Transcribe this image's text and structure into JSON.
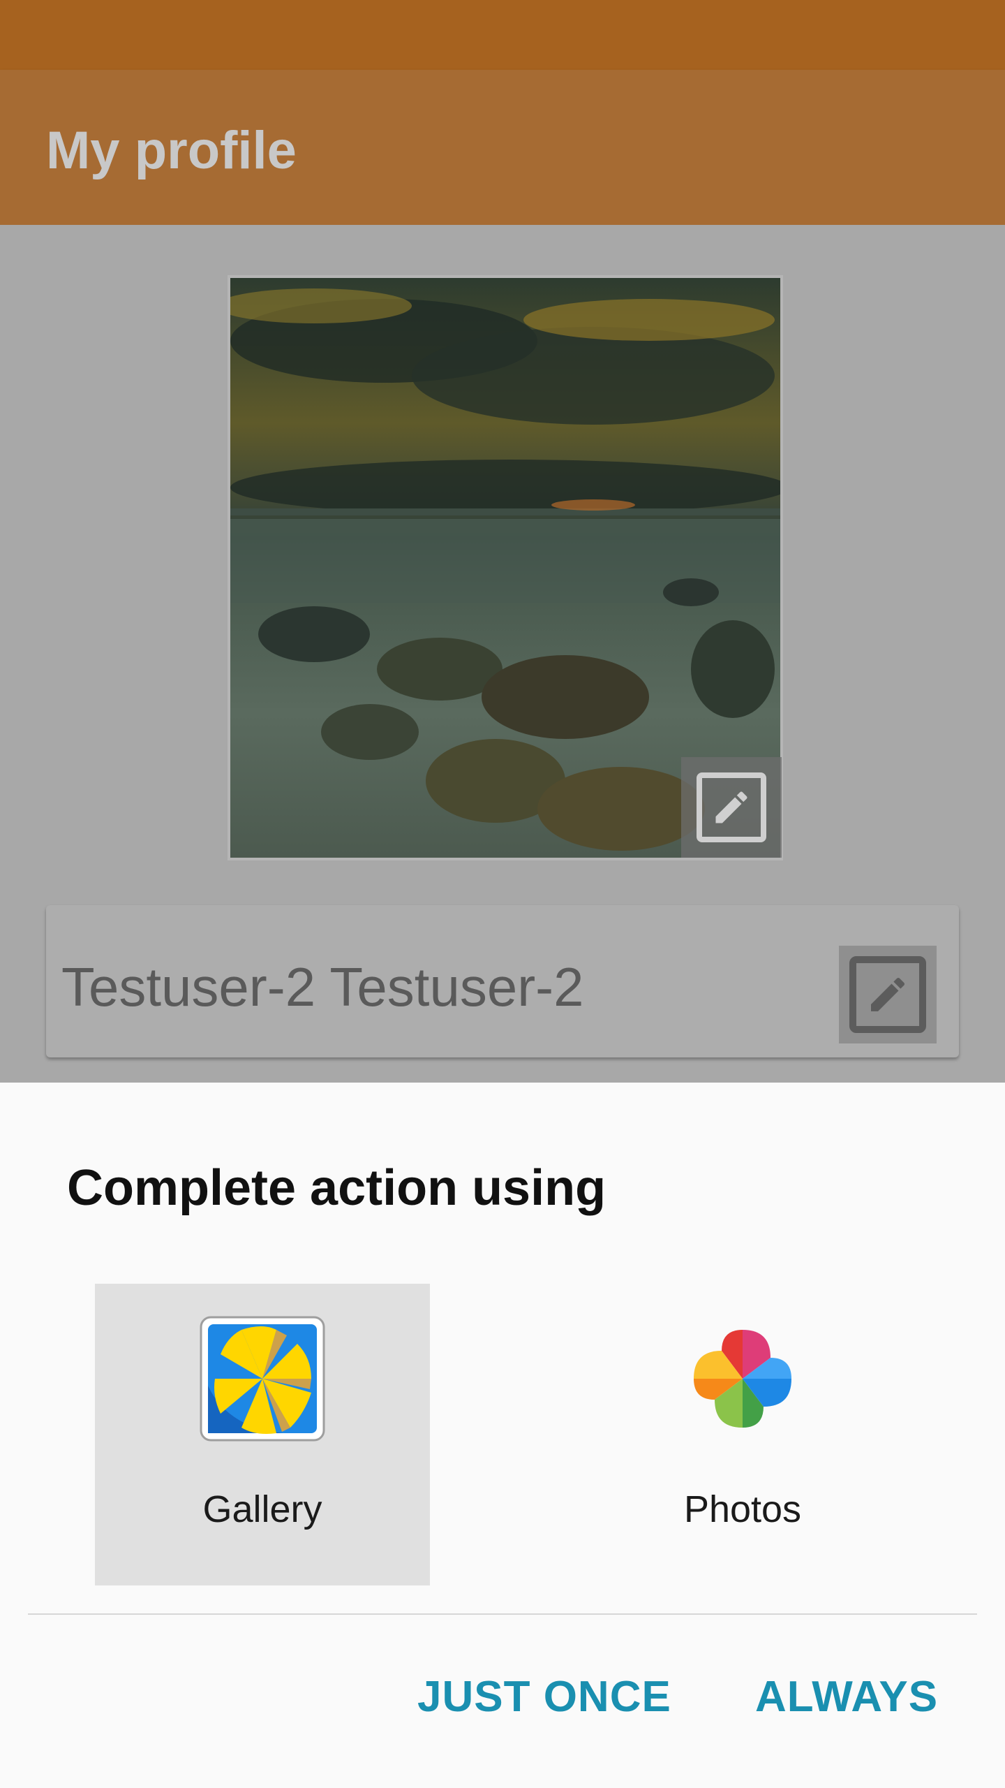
{
  "appbar": {
    "title": "My profile"
  },
  "profile": {
    "name": "Testuser-2 Testuser-2"
  },
  "chooser": {
    "heading": "Complete action using",
    "apps": [
      {
        "label": "Gallery",
        "icon": "gallery-icon",
        "selected": true
      },
      {
        "label": "Photos",
        "icon": "photos-pinwheel-icon",
        "selected": false
      }
    ],
    "buttons": {
      "just_once": "JUST ONCE",
      "always": "ALWAYS"
    },
    "accent_color": "#1a8fb0"
  },
  "colors": {
    "statusbar": "#a6621f",
    "appbar": "#a66b33",
    "scrim": "#a8a8a8"
  }
}
